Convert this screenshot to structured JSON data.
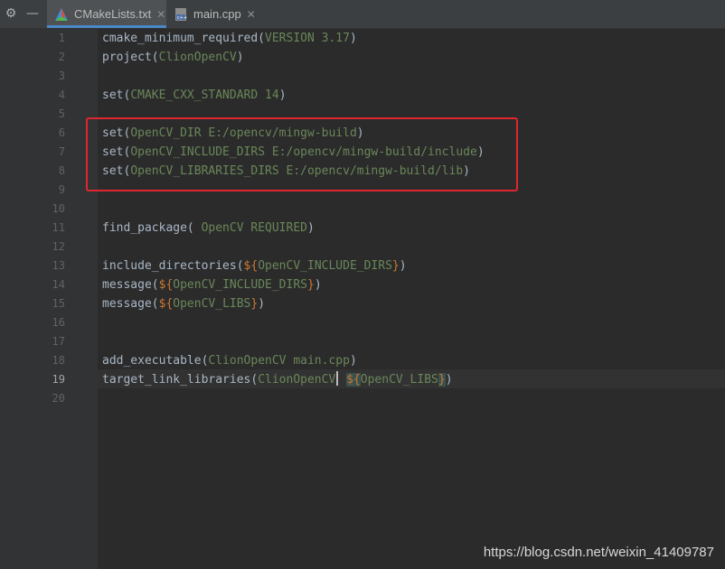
{
  "tabs": [
    {
      "label": "CMakeLists.txt",
      "icon": "cmake-icon",
      "active": true
    },
    {
      "label": "main.cpp",
      "icon": "cpp-file-icon",
      "active": false
    }
  ],
  "toolbar": {
    "settings_icon": "gear-icon",
    "hide_icon": "minimize-icon"
  },
  "line_numbers": [
    "1",
    "2",
    "3",
    "4",
    "5",
    "6",
    "7",
    "8",
    "9",
    "10",
    "11",
    "12",
    "13",
    "14",
    "15",
    "16",
    "17",
    "18",
    "19",
    "20"
  ],
  "current_line": "19",
  "code": {
    "l1": {
      "fn": "cmake_minimum_required(",
      "arg": "VERSION 3.17",
      "close": ")"
    },
    "l2": {
      "fn": "project(",
      "arg": "ClionOpenCV",
      "close": ")"
    },
    "l4": {
      "fn": "set(",
      "arg": "CMAKE_CXX_STANDARD 14",
      "close": ")"
    },
    "l6": {
      "fn": "set(",
      "arg": "OpenCV_DIR E:/opencv/mingw-build",
      "close": ")"
    },
    "l7": {
      "fn": "set(",
      "arg": "OpenCV_INCLUDE_DIRS E:/opencv/mingw-build/include",
      "close": ")"
    },
    "l8": {
      "fn": "set(",
      "arg": "OpenCV_LIBRARIES_DIRS E:/opencv/mingw-build/lib",
      "close": ")"
    },
    "l11": {
      "fn": "find_package( ",
      "arg": "OpenCV REQUIRED",
      "close": ")"
    },
    "l13": {
      "fn": "include_directories(",
      "open": "${",
      "arg": "OpenCV_INCLUDE_DIRS",
      "brace": "}",
      "close": ")"
    },
    "l14": {
      "fn": "message(",
      "open": "${",
      "arg": "OpenCV_INCLUDE_DIRS",
      "brace": "}",
      "close": ")"
    },
    "l15": {
      "fn": "message(",
      "open": "${",
      "arg": "OpenCV_LIBS",
      "brace": "}",
      "close": ")"
    },
    "l18": {
      "fn": "add_executable(",
      "arg": "ClionOpenCV main.cpp",
      "close": ")"
    },
    "l19": {
      "fn": "target_link_libraries(",
      "arg": "ClionOpenCV",
      "sp": " ",
      "open": "${",
      "arg2": "OpenCV_LIBS",
      "brace": "}",
      "close": ")"
    }
  },
  "watermark": "https://blog.csdn.net/weixin_41409787",
  "colors": {
    "highlight_box": "#e0262e",
    "active_tab_underline": "#4a88c7"
  }
}
